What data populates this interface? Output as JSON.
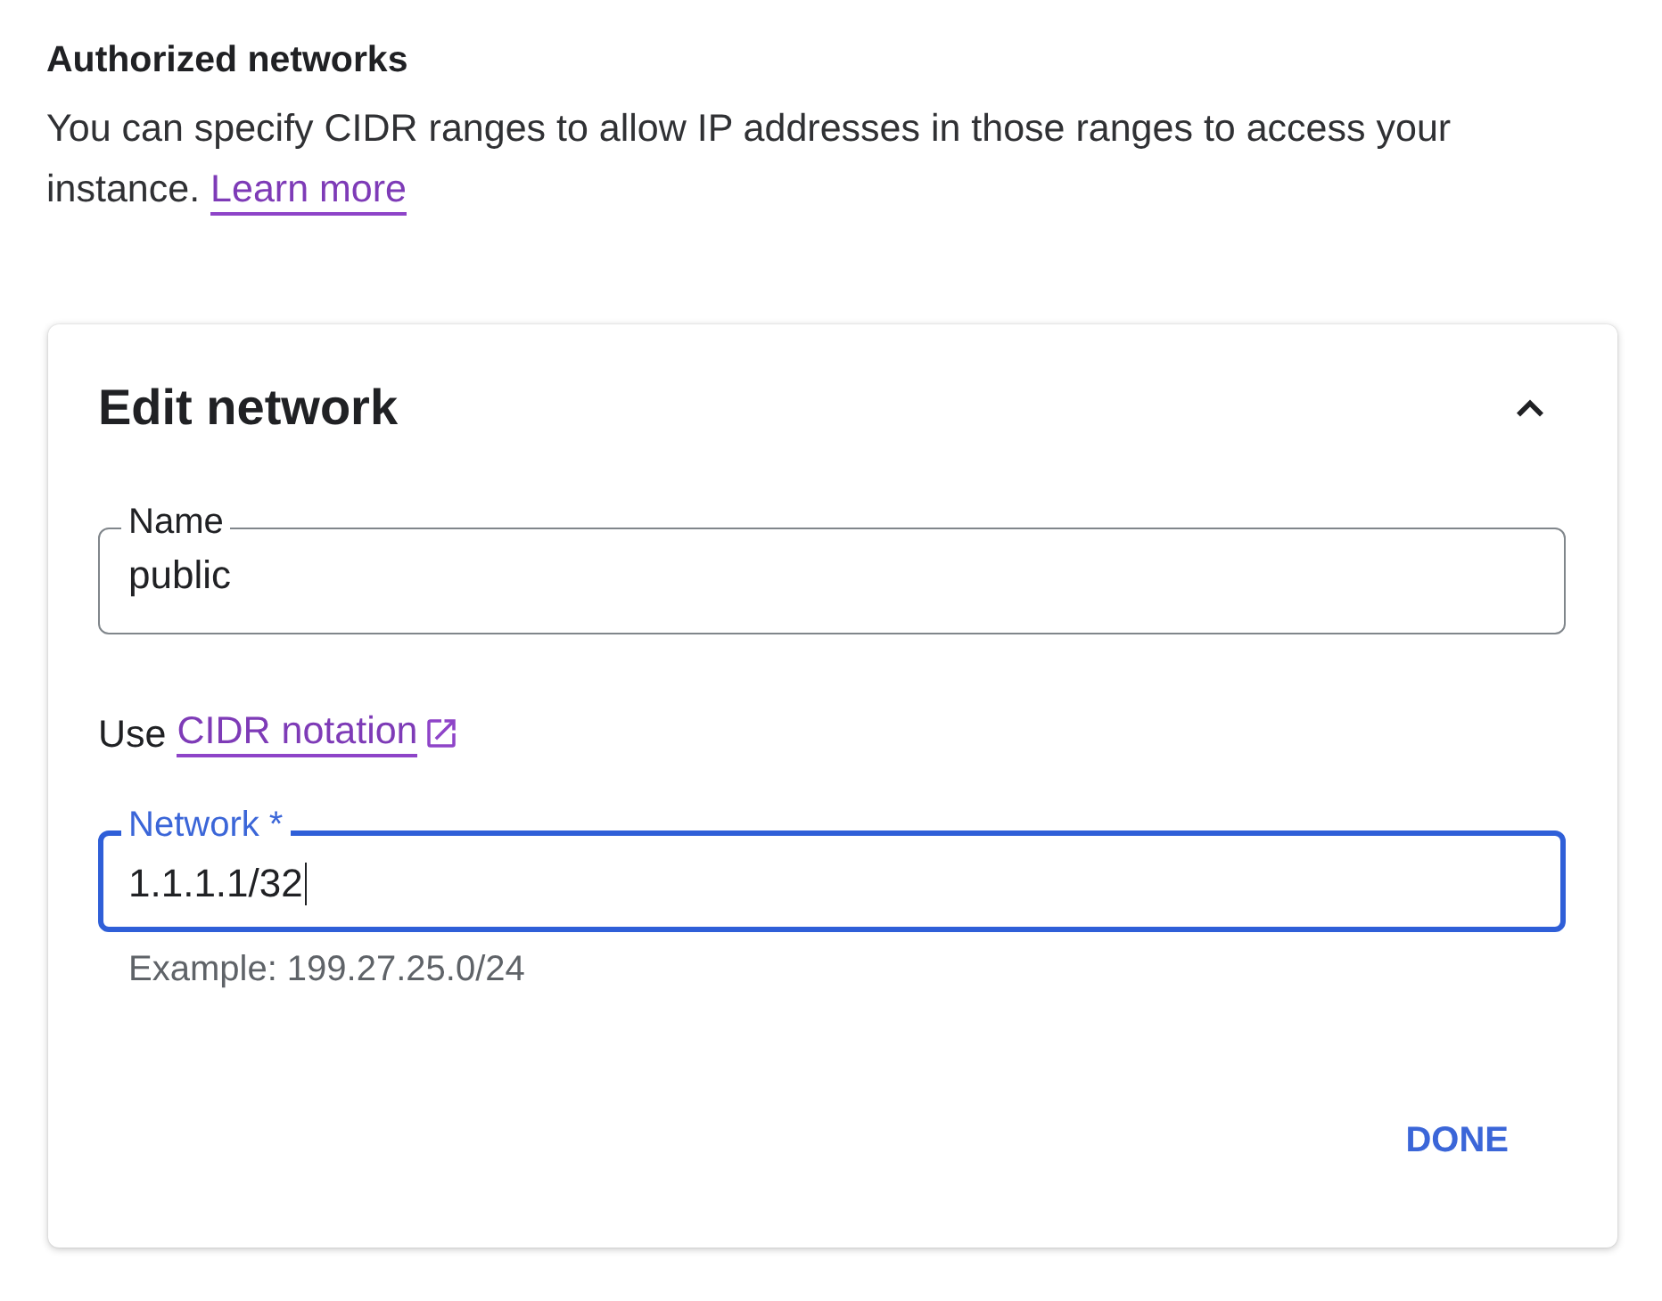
{
  "section": {
    "title": "Authorized networks",
    "description": "You can specify CIDR ranges to allow IP addresses in those ranges to access your instance.",
    "link": "Learn more"
  },
  "card": {
    "title": "Edit network",
    "expanded": true,
    "items": [
      {
        "kind": "field",
        "label": "Name",
        "value": "public",
        "focused": false
      },
      {
        "kind": "hint",
        "text": "Use",
        "link": "CIDR notation"
      },
      {
        "kind": "field",
        "label": "Network *",
        "value": "1.1.1.1/32",
        "focused": true,
        "helper": "Example: 199.27.25.0/24"
      }
    ],
    "buttons": [
      "DONE"
    ]
  }
}
